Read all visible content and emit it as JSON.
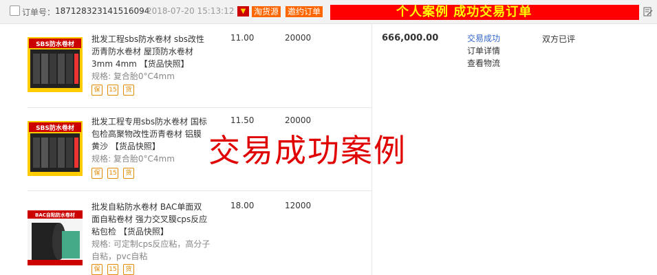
{
  "order": {
    "number_label": "订单号：",
    "number": "187128323141516094",
    "datetime": "2018-07-20 15:13:12",
    "tags": [
      "淘货源",
      "邀约订单"
    ],
    "banner": "个人案例  成功交易订单",
    "total": "666,000.00",
    "status_links": [
      "交易成功",
      "订单详情",
      "查看物流"
    ],
    "review": "双方已评"
  },
  "items": [
    {
      "title": "批发工程sbs防水卷材 sbs改性沥青防水卷材 屋顶防水卷材3mm 4mm",
      "tag": "【货品快照】",
      "spec": "规格: 复合胎0°C4mm",
      "price": "11.00",
      "qty": "20000",
      "thumb_text": "SBS防水卷材",
      "badges": [
        "保",
        "15",
        "货"
      ]
    },
    {
      "title": "批发工程专用sbs防水卷材 国标包检高聚物改性沥青卷材 铝膜黄沙",
      "tag": "【货品快照】",
      "spec": "规格: 复合胎0°C4mm",
      "price": "11.50",
      "qty": "20000",
      "thumb_text": "SBS防水卷材",
      "badges": [
        "保",
        "15",
        "货"
      ]
    },
    {
      "title": "批发自粘防水卷材 BAC单面双面自粘卷材 强力交叉膜cps反应粘包检",
      "tag": "【货品快照】",
      "spec": "规格: 可定制cps反应粘，高分子自粘，pvc自粘",
      "price": "18.00",
      "qty": "12000",
      "thumb_text": "BAC自粘防水卷材",
      "badges": [
        "保",
        "15",
        "货"
      ]
    }
  ],
  "watermark": "交易成功案例",
  "colors": {
    "banner_bg": "#ff0000",
    "banner_text": "#ffff00",
    "tag_bg": "#ff6600",
    "link": "#3366cc",
    "watermark": "#e00000"
  }
}
